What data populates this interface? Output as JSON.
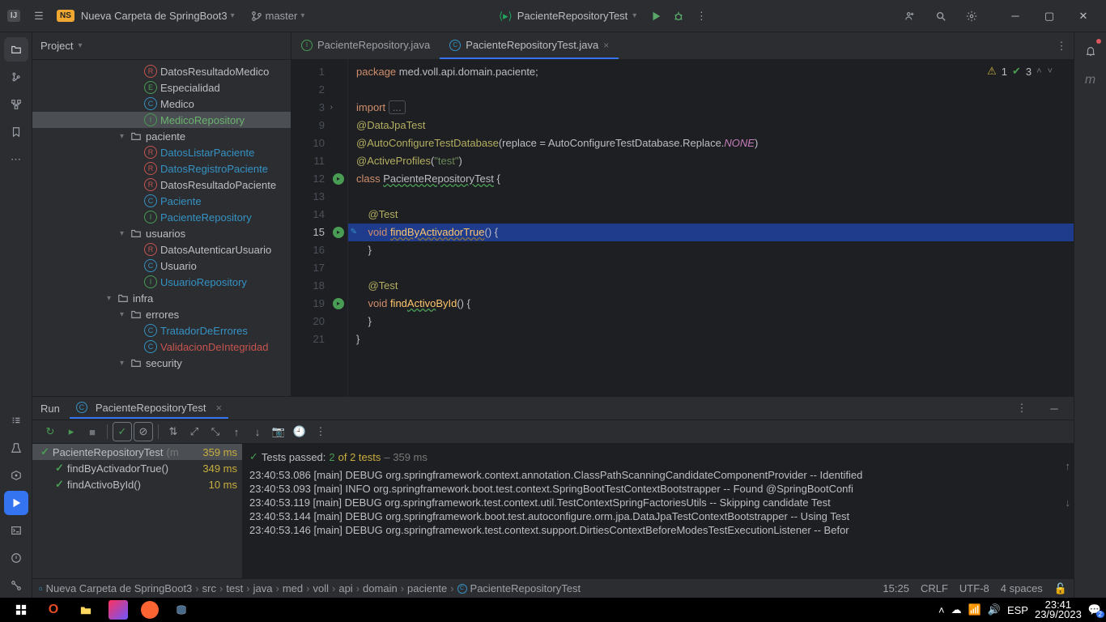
{
  "titlebar": {
    "logo_text": "IJ",
    "ns": "NS",
    "project_name": "Nueva Carpeta de SpringBoot3",
    "branch": "master",
    "run_config": "PacienteRepositoryTest"
  },
  "project_pane": {
    "title": "Project",
    "tree": [
      {
        "pad": 138,
        "ico": "R",
        "icoCls": "ico-r-red",
        "label": "DatosResultadoMedico"
      },
      {
        "pad": 138,
        "ico": "E",
        "icoCls": "ico-e-green",
        "label": "Especialidad"
      },
      {
        "pad": 138,
        "ico": "C",
        "icoCls": "ico-c-blue",
        "label": "Medico"
      },
      {
        "pad": 138,
        "ico": "I",
        "icoCls": "ico-i-green",
        "label": "MedicoRepository",
        "cls": "sel",
        "selected": true
      },
      {
        "pad": 108,
        "chev": "▾",
        "folder": true,
        "label": "paciente"
      },
      {
        "pad": 138,
        "ico": "R",
        "icoCls": "ico-r-red",
        "label": "DatosListarPaciente",
        "cls": "link"
      },
      {
        "pad": 138,
        "ico": "R",
        "icoCls": "ico-r-red",
        "label": "DatosRegistroPaciente",
        "cls": "link"
      },
      {
        "pad": 138,
        "ico": "R",
        "icoCls": "ico-r-red",
        "label": "DatosResultadoPaciente"
      },
      {
        "pad": 138,
        "ico": "C",
        "icoCls": "ico-c-blue",
        "label": "Paciente",
        "cls": "link"
      },
      {
        "pad": 138,
        "ico": "I",
        "icoCls": "ico-i-green",
        "label": "PacienteRepository",
        "cls": "link"
      },
      {
        "pad": 108,
        "chev": "▾",
        "folder": true,
        "label": "usuarios"
      },
      {
        "pad": 138,
        "ico": "R",
        "icoCls": "ico-r-red",
        "label": "DatosAutenticarUsuario"
      },
      {
        "pad": 138,
        "ico": "C",
        "icoCls": "ico-c-blue",
        "label": "Usuario"
      },
      {
        "pad": 138,
        "ico": "I",
        "icoCls": "ico-i-green",
        "label": "UsuarioRepository",
        "cls": "link"
      },
      {
        "pad": 92,
        "chev": "▾",
        "folder": true,
        "label": "infra"
      },
      {
        "pad": 108,
        "chev": "▾",
        "folder": true,
        "label": "errores"
      },
      {
        "pad": 138,
        "ico": "C",
        "icoCls": "ico-c-blue",
        "label": "TratadorDeErrores",
        "cls": "link"
      },
      {
        "pad": 138,
        "ico": "C",
        "icoCls": "ico-c-blue",
        "label": "ValidacionDeIntegridad",
        "cls": "red"
      },
      {
        "pad": 108,
        "chev": "▾",
        "folder": true,
        "label": "security"
      }
    ]
  },
  "tabs": [
    {
      "ico": "I",
      "icoCls": "tab-ico-i",
      "label": "PacienteRepository.java",
      "active": false,
      "close": false
    },
    {
      "ico": "C",
      "icoCls": "tab-ico-c",
      "label": "PacienteRepositoryTest.java",
      "active": true,
      "close": true
    }
  ],
  "inspection": {
    "warn_count": "1",
    "ok_count": "3"
  },
  "gutter": [
    "1",
    "2",
    "3",
    "9",
    "10",
    "11",
    "12",
    "13",
    "14",
    "15",
    "16",
    "17",
    "18",
    "19",
    "20",
    "21"
  ],
  "run": {
    "title": "Run",
    "tab_label": "PacienteRepositoryTest",
    "summary_pre": "Tests passed: ",
    "summary_count": "2",
    "summary_of": " of 2 tests",
    "summary_time": " – 359 ms",
    "tree": [
      {
        "pad": 4,
        "sel": true,
        "label": "PacienteRepositoryTest",
        "dim": "(m",
        "ms": "359 ms"
      },
      {
        "pad": 22,
        "label": "findByActivadorTrue()",
        "ms": "349 ms"
      },
      {
        "pad": 22,
        "label": "findActivoById()",
        "ms": "10 ms"
      }
    ],
    "console": [
      "23:40:53.086 [main] DEBUG org.springframework.context.annotation.ClassPathScanningCandidateComponentProvider -- Identified",
      "23:40:53.093 [main] INFO org.springframework.boot.test.context.SpringBootTestContextBootstrapper -- Found @SpringBootConfi",
      "23:40:53.119 [main] DEBUG org.springframework.test.context.util.TestContextSpringFactoriesUtils -- Skipping candidate Test",
      "23:40:53.144 [main] DEBUG org.springframework.boot.test.autoconfigure.orm.jpa.DataJpaTestContextBootstrapper -- Using Test",
      "23:40:53.146 [main] DEBUG org.springframework.test.context.support.DirtiesContextBeforeModesTestExecutionListener -- Befor"
    ]
  },
  "breadcrumb": [
    "Nueva Carpeta de SpringBoot3",
    "src",
    "test",
    "java",
    "med",
    "voll",
    "api",
    "domain",
    "paciente",
    "PacienteRepositoryTest"
  ],
  "status": {
    "pos": "15:25",
    "le": "CRLF",
    "enc": "UTF-8",
    "indent": "4 spaces"
  },
  "tray": {
    "lang": "ESP",
    "time": "23:41",
    "date": "23/9/2023",
    "notif": "2"
  }
}
